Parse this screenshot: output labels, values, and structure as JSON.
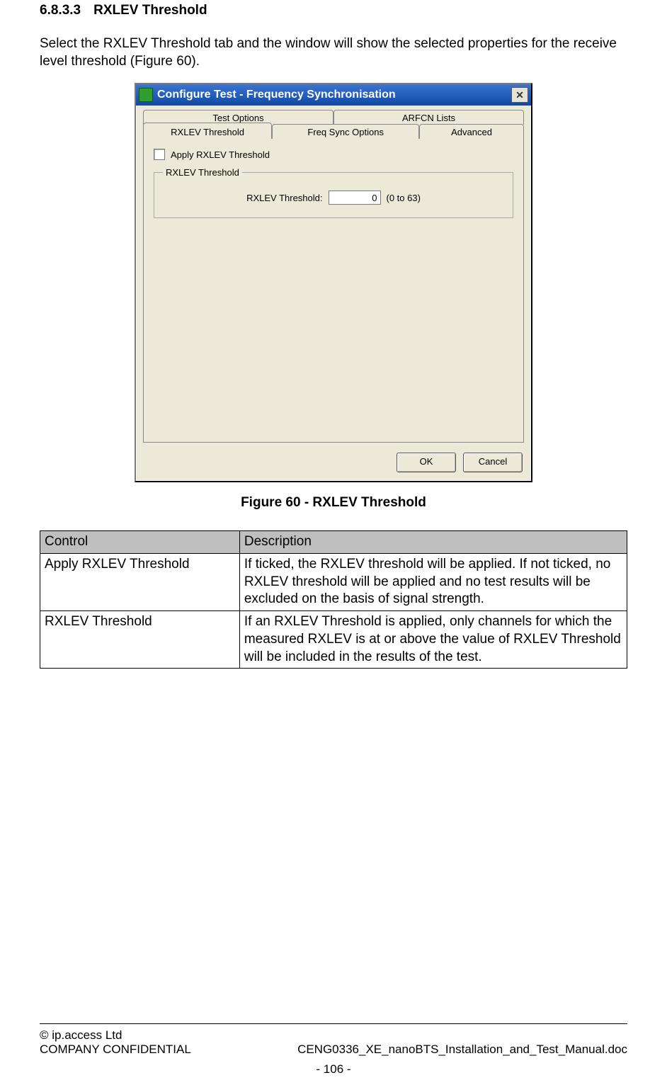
{
  "heading": {
    "number": "6.8.3.3",
    "title": "RXLEV Threshold"
  },
  "intro": "Select the RXLEV Threshold tab and the window will show the selected properties for the receive level threshold (Figure 60).",
  "dialog": {
    "title": "Configure Test - Frequency Synchronisation",
    "tabs_row1": [
      "Test Options",
      "ARFCN Lists"
    ],
    "tabs_row2": [
      "RXLEV Threshold",
      "Freq Sync Options",
      "Advanced"
    ],
    "apply_label": "Apply RXLEV Threshold",
    "groupbox_label": "RXLEV Threshold",
    "field_label": "RXLEV Threshold:",
    "field_value": "0",
    "field_hint": "(0 to 63)",
    "ok_label": "OK",
    "cancel_label": "Cancel"
  },
  "figure_caption": "Figure 60 - RXLEV Threshold",
  "table": {
    "headers": [
      "Control",
      "Description"
    ],
    "rows": [
      {
        "control": "Apply RXLEV Threshold",
        "description": "If ticked, the RXLEV threshold will be applied. If not ticked, no RXLEV threshold will be applied and no test results will be excluded on the basis of signal strength."
      },
      {
        "control": "RXLEV Threshold",
        "description": "If an RXLEV Threshold is applied, only channels for which the measured RXLEV is at or above the value of RXLEV Threshold will be included in the results of the test."
      }
    ]
  },
  "footer": {
    "copyright": "© ip.access Ltd",
    "confidential": "COMPANY CONFIDENTIAL",
    "docname": "CENG0336_XE_nanoBTS_Installation_and_Test_Manual.doc",
    "page": "- 106 -"
  }
}
